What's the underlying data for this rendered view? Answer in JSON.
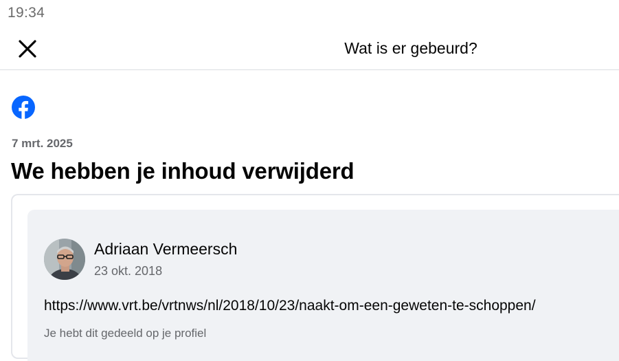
{
  "status_bar": {
    "time": "19:34"
  },
  "header": {
    "title": "Wat is er gebeurd?",
    "close_icon": "close-icon"
  },
  "notice": {
    "logo_icon": "facebook-logo-icon",
    "date": "7 mrt. 2025",
    "headline": "We hebben je inhoud verwijderd"
  },
  "post": {
    "author": "Adriaan Vermeersch",
    "date": "23 okt. 2018",
    "link": "https://www.vrt.be/vrtnws/nl/2018/10/23/naakt-om-een-geweten-te-schoppen/",
    "shared_note": "Je hebt dit gedeeld op je profiel"
  },
  "colors": {
    "facebook_blue": "#0866ff",
    "secondary_text": "#65676b",
    "card_background": "#f0f2f5",
    "divider": "#dadde1"
  }
}
